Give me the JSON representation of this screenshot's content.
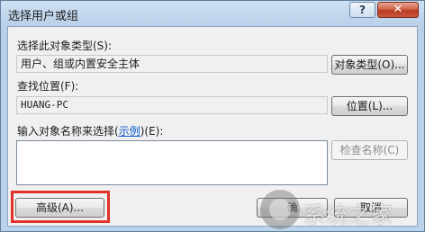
{
  "window": {
    "title": "选择用户或组",
    "help_symbol": "?",
    "close_symbol": "✕"
  },
  "object_type": {
    "label": "选择此对象类型(S):",
    "value": "用户、组或内置安全主体",
    "button": "对象类型(O)..."
  },
  "location": {
    "label": "查找位置(F):",
    "value": "HUANG-PC",
    "button": "位置(L)..."
  },
  "names": {
    "label_prefix": "输入对象名称来选择(",
    "label_link": "示例",
    "label_suffix": ")(E):",
    "value": "",
    "check_button": "检查名称(C)"
  },
  "footer": {
    "advanced_button": "高级(A)...",
    "ok_button": "确",
    "cancel_button": "取消"
  },
  "watermark": {
    "text": "系统之家"
  },
  "colors": {
    "highlight": "#e0322b",
    "link": "#0b57d0"
  }
}
